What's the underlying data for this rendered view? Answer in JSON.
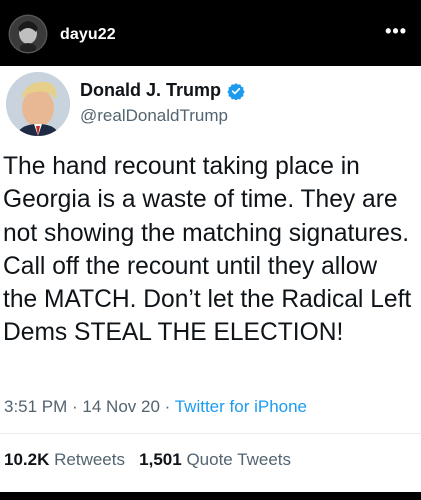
{
  "instagram": {
    "username": "dayu22",
    "more_icon": "more-horizontal-icon"
  },
  "tweet": {
    "display_name": "Donald J. Trump",
    "handle": "@realDonaldTrump",
    "verified_icon": "verified-badge-icon",
    "text": "The hand recount taking place in Georgia is a waste of time. They are not showing the matching signatures. Call off the recount until they allow the MATCH. Don’t let the Radical Left Dems STEAL THE ELECTION!",
    "time": "3:51 PM",
    "separator": " · ",
    "date": "14 Nov 20",
    "source": "Twitter for iPhone",
    "retweets_count": "10.2K",
    "retweets_label": "Retweets",
    "quote_count": "1,501",
    "quote_label": "Quote Tweets"
  },
  "colors": {
    "twitter_blue": "#1d9bf0",
    "text_primary": "#0f1419",
    "text_secondary": "#536471"
  }
}
